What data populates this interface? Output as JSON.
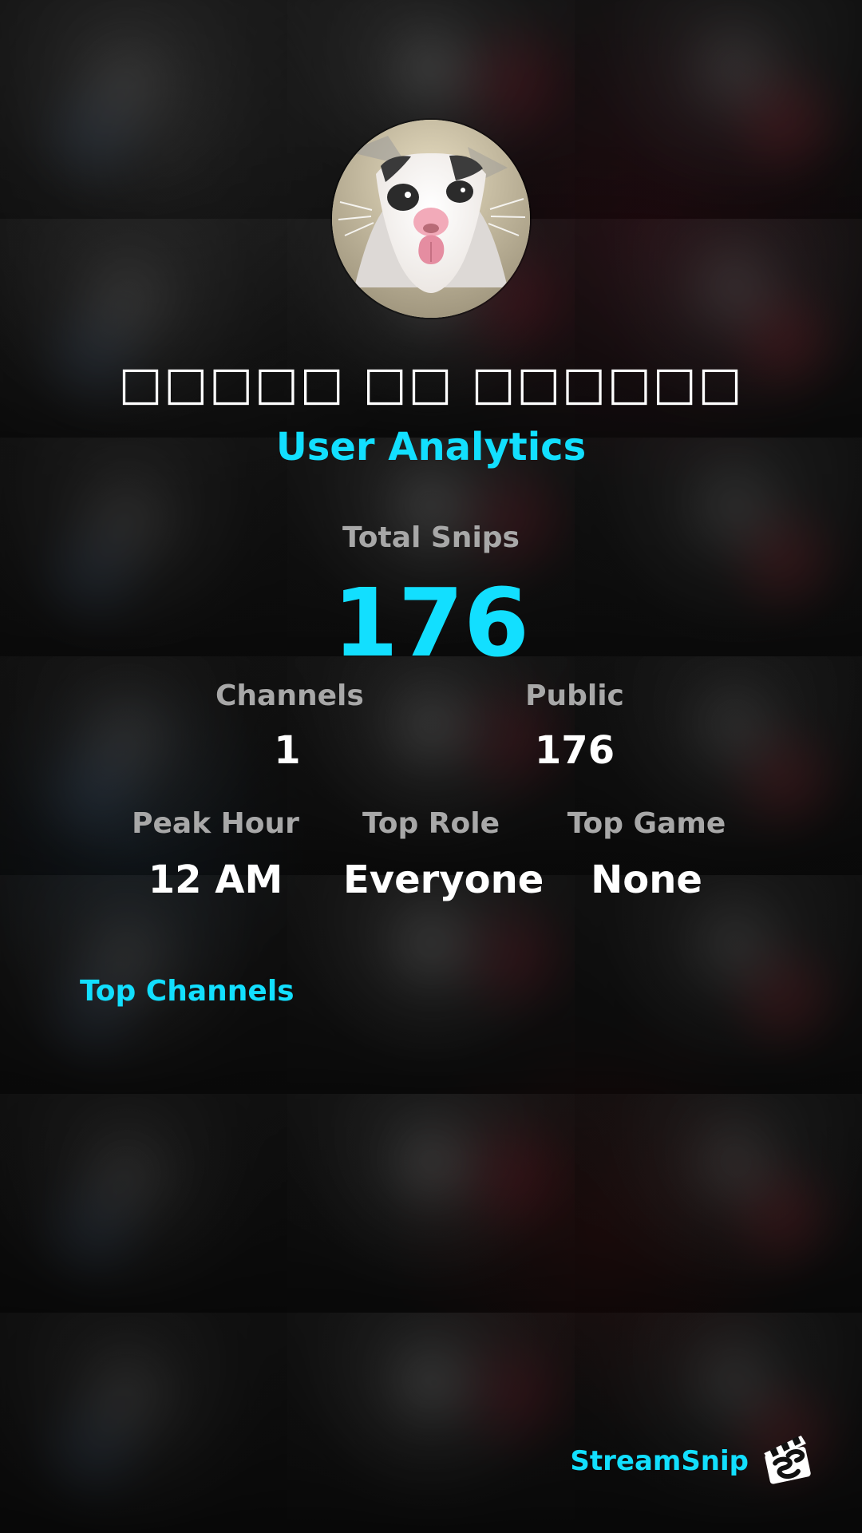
{
  "profile": {
    "display_name": "□□□□□ □□ □□□□□□",
    "subtitle": "User Analytics"
  },
  "stats": {
    "total_snips_label": "Total Snips",
    "total_snips_value": "176",
    "channels_label": "Channels",
    "channels_value": "1",
    "public_label": "Public",
    "public_value": "176",
    "peak_hour_label": "Peak Hour",
    "peak_hour_value": "12 AM",
    "top_role_label": "Top Role",
    "top_role_value": "Everyone",
    "top_game_label": "Top Game",
    "top_game_value": "None"
  },
  "sections": {
    "top_channels_label": "Top Channels"
  },
  "branding": {
    "name": "StreamSnip",
    "logo_icon": "clapperboard-logo-icon",
    "accent_color": "#12dfff"
  },
  "avatar": {
    "icon": "cat-avatar-icon"
  }
}
